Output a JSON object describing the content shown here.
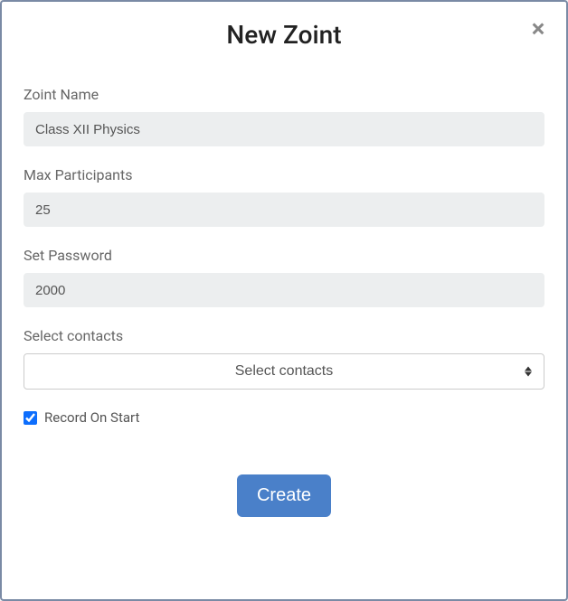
{
  "modal": {
    "title": "New Zoint",
    "close_label": "×"
  },
  "form": {
    "zoint_name": {
      "label": "Zoint Name",
      "value": "Class XII Physics"
    },
    "max_participants": {
      "label": "Max Participants",
      "value": "25"
    },
    "set_password": {
      "label": "Set Password",
      "value": "2000"
    },
    "select_contacts": {
      "label": "Select contacts",
      "selected": "Select contacts"
    },
    "record_on_start": {
      "label": "Record On Start",
      "checked": true
    }
  },
  "footer": {
    "create_label": "Create"
  }
}
